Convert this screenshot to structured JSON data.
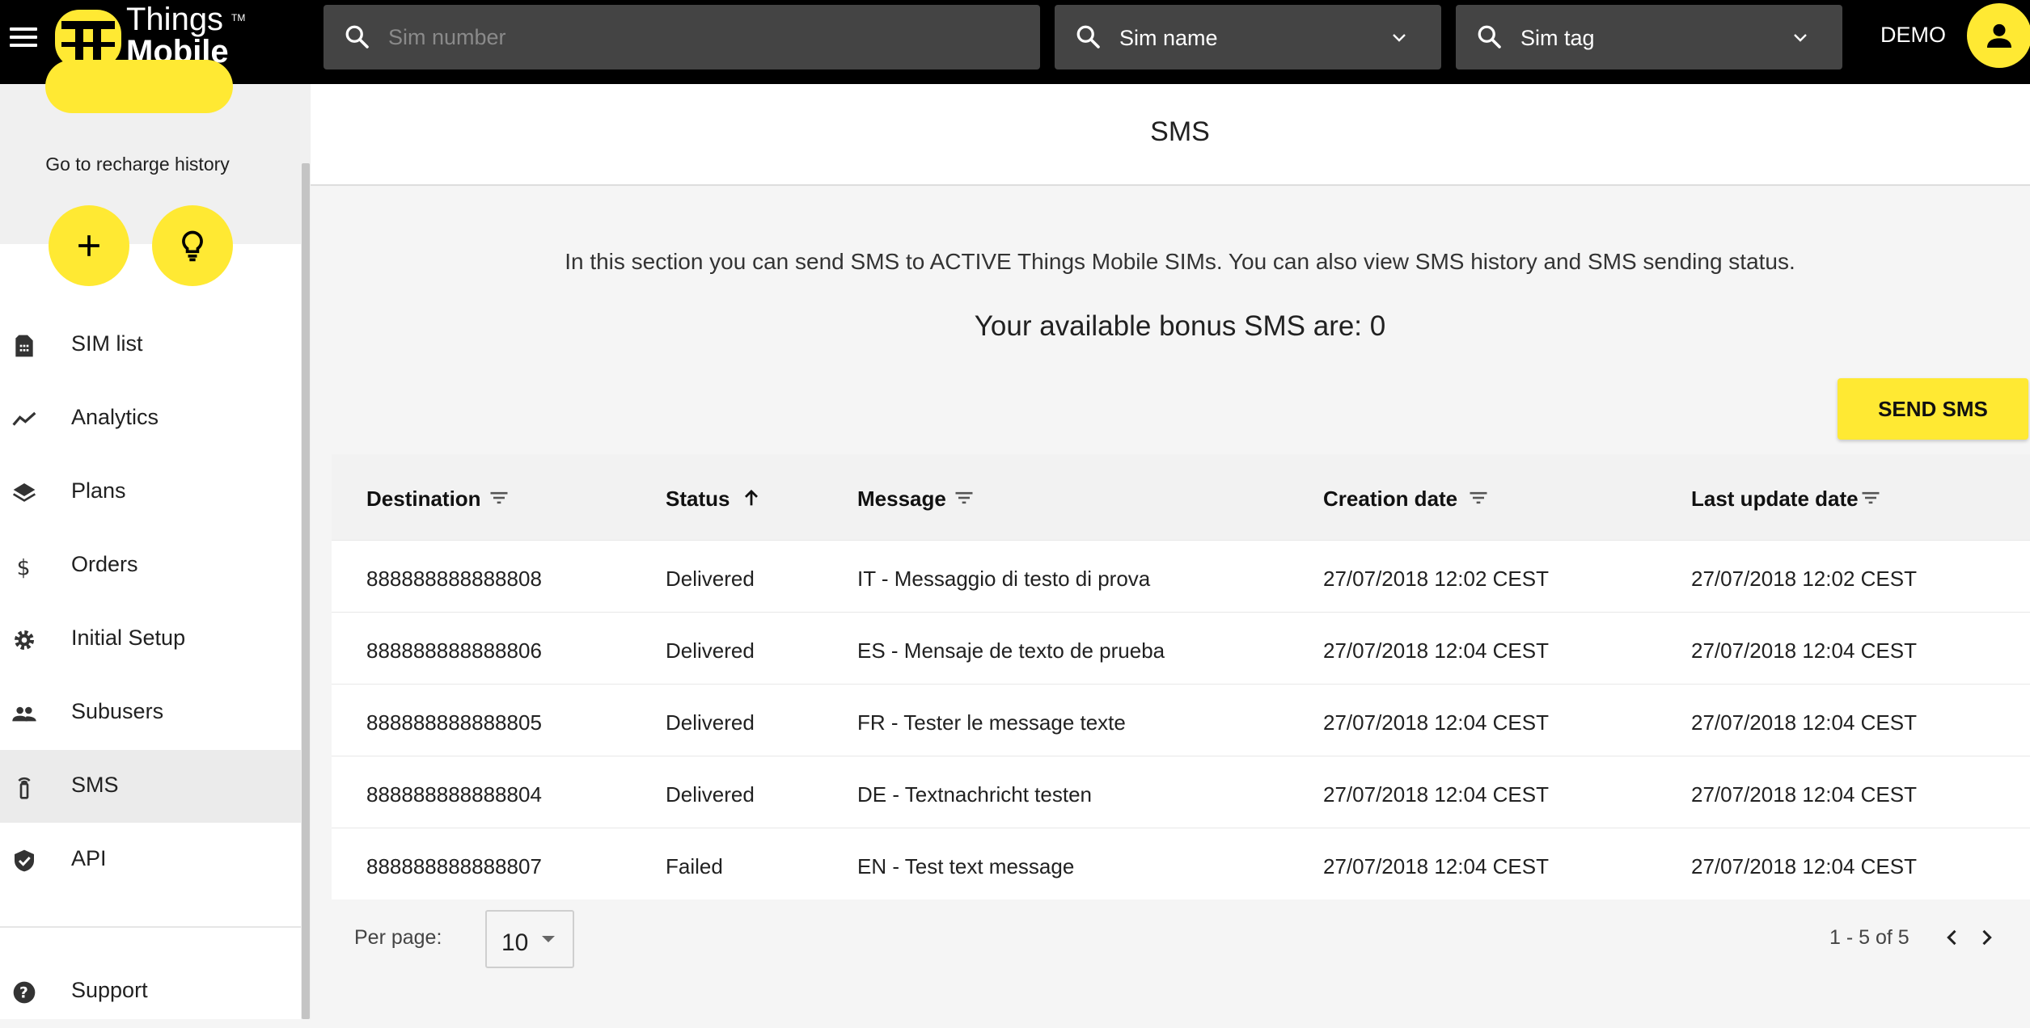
{
  "brand": {
    "line1": "Things",
    "line2": "Mobile",
    "tm": "TM"
  },
  "search": {
    "sim_number_placeholder": "Sim number",
    "sim_name_label": "Sim name",
    "sim_tag_label": "Sim tag"
  },
  "user": {
    "label": "DEMO"
  },
  "colors": {
    "accent": "#ffe933",
    "topbar": "#000000",
    "search_bg": "#444444"
  },
  "sidebar": {
    "recharge_link": "Go to recharge history",
    "items": [
      {
        "label": "SIM list",
        "icon": "sim-card-icon"
      },
      {
        "label": "Analytics",
        "icon": "trending-icon"
      },
      {
        "label": "Plans",
        "icon": "layers-icon"
      },
      {
        "label": "Orders",
        "icon": "dollar-icon"
      },
      {
        "label": "Initial Setup",
        "icon": "gear-icon"
      },
      {
        "label": "Subusers",
        "icon": "people-icon"
      },
      {
        "label": "SMS",
        "icon": "sms-tower-icon",
        "active": true
      },
      {
        "label": "API",
        "icon": "shield-check-icon"
      }
    ],
    "support": {
      "label": "Support",
      "icon": "help-icon"
    }
  },
  "main": {
    "title": "SMS",
    "intro": "In this section you can send SMS to ACTIVE Things Mobile SIMs. You can also view SMS history and SMS sending status.",
    "bonus": "Your available bonus SMS are: 0",
    "send_button": "SEND SMS"
  },
  "table": {
    "columns": [
      "Destination",
      "Status",
      "Message",
      "Creation date",
      "Last update date"
    ],
    "rows": [
      {
        "destination": "888888888888808",
        "status": "Delivered",
        "message": "IT - Messaggio di testo di prova",
        "created": "27/07/2018 12:02 CEST",
        "updated": "27/07/2018 12:02 CEST"
      },
      {
        "destination": "888888888888806",
        "status": "Delivered",
        "message": "ES - Mensaje de texto de prueba",
        "created": "27/07/2018 12:04 CEST",
        "updated": "27/07/2018 12:04 CEST"
      },
      {
        "destination": "888888888888805",
        "status": "Delivered",
        "message": "FR - Tester le message texte",
        "created": "27/07/2018 12:04 CEST",
        "updated": "27/07/2018 12:04 CEST"
      },
      {
        "destination": "888888888888804",
        "status": "Delivered",
        "message": "DE - Textnachricht testen",
        "created": "27/07/2018 12:04 CEST",
        "updated": "27/07/2018 12:04 CEST"
      },
      {
        "destination": "888888888888807",
        "status": "Failed",
        "message": "EN - Test text message",
        "created": "27/07/2018 12:04 CEST",
        "updated": "27/07/2018 12:04 CEST"
      }
    ]
  },
  "pagination": {
    "per_page_label": "Per page:",
    "per_page_value": "10",
    "range": "1 - 5 of 5"
  }
}
